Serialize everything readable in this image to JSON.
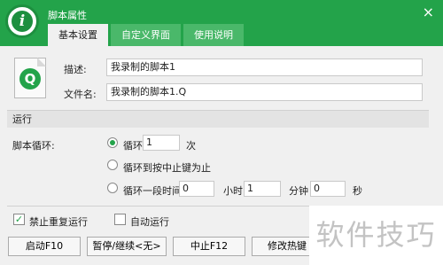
{
  "window": {
    "title": "脚本属性",
    "close_glyph": "×"
  },
  "tabs": [
    {
      "label": "基本设置",
      "active": true
    },
    {
      "label": "自定义界面",
      "active": false
    },
    {
      "label": "使用说明",
      "active": false
    }
  ],
  "form": {
    "desc_label": "描述:",
    "desc_value": "我录制的脚本1",
    "file_label": "文件名:",
    "file_value": "我录制的脚本1.Q"
  },
  "run": {
    "section_label": "运行",
    "loop_label": "脚本循环:",
    "opt_loop_label": "循环",
    "loop_count": "1",
    "loop_unit": "次",
    "opt_until_stop_label": "循环到按中止键为止",
    "opt_duration_label": "循环一段时间",
    "duration_value1": "0",
    "hour_unit": "小时",
    "duration_hours": "1",
    "minute_unit": "分钟",
    "duration_minutes": "0",
    "second_unit": "秒",
    "selected_option": "loop"
  },
  "options": {
    "no_repeat_label": "禁止重复运行",
    "no_repeat_checked": true,
    "auto_run_label": "自动运行",
    "auto_run_checked": false
  },
  "buttons": {
    "start": "启动F10",
    "pause": "暂停/继续<无>",
    "stop": "中止F12",
    "hotkey": "修改热键"
  },
  "watermark": "软件技巧",
  "colors": {
    "accent": "#23a34a"
  },
  "icons": {
    "logo": "info-i-icon",
    "script_file": "script-file-icon"
  }
}
